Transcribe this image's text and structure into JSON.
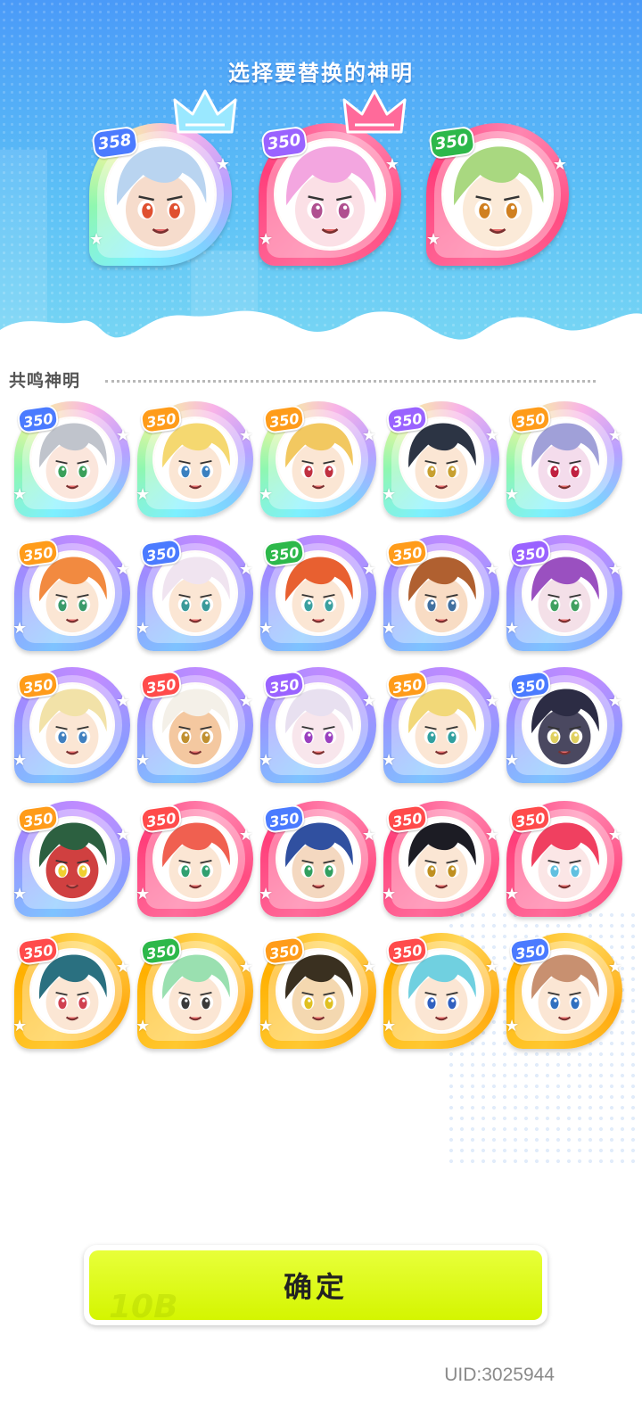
{
  "banner": {
    "title": "选择要替换的神明",
    "selected": [
      {
        "level": "358",
        "frame": "rainbow",
        "badge": "b-blue",
        "hair": "#b9d4f0",
        "skin": "#f6dccc",
        "eyes": "#e05030",
        "crown": "#9ae8ff",
        "crown_icon": "crown-icon"
      },
      {
        "level": "350",
        "frame": "pink",
        "badge": "b-purple",
        "hair": "#f3a6e0",
        "skin": "#fbe0e6",
        "eyes": "#b05090",
        "crown": "#ff6a9a",
        "crown_icon": "crown-icon"
      },
      {
        "level": "350",
        "frame": "pink",
        "badge": "b-green",
        "hair": "#a9d880",
        "skin": "#fbead8",
        "eyes": "#d08020",
        "crown": "",
        "crown_icon": ""
      }
    ]
  },
  "section": {
    "title": "共鸣神明"
  },
  "deities": [
    {
      "level": "350",
      "frame": "rainbow",
      "badge": "b-blue",
      "hair": "#c0c4cc",
      "skin": "#fbe6dc",
      "eyes": "#3aa05a"
    },
    {
      "level": "350",
      "frame": "rainbow",
      "badge": "b-orange",
      "hair": "#f5d870",
      "skin": "#fbe6d4",
      "eyes": "#3a80c0"
    },
    {
      "level": "350",
      "frame": "rainbow",
      "badge": "b-orange",
      "hair": "#f2c860",
      "skin": "#fbe6d4",
      "eyes": "#c03040"
    },
    {
      "level": "350",
      "frame": "rainbow",
      "badge": "b-purple",
      "hair": "#2c3444",
      "skin": "#fbe6d4",
      "eyes": "#c8a030"
    },
    {
      "level": "350",
      "frame": "rainbow",
      "badge": "b-orange",
      "hair": "#a0a0d8",
      "skin": "#f4dcec",
      "eyes": "#c02040"
    },
    {
      "level": "350",
      "frame": "purple",
      "badge": "b-orange",
      "hair": "#f28a40",
      "skin": "#fbe6d4",
      "eyes": "#3a9a6a"
    },
    {
      "level": "350",
      "frame": "purple",
      "badge": "b-blue",
      "hair": "#f0e4f0",
      "skin": "#fbe6d4",
      "eyes": "#3a9a9a"
    },
    {
      "level": "350",
      "frame": "purple",
      "badge": "b-green",
      "hair": "#e86030",
      "skin": "#fbe6d4",
      "eyes": "#3aa0a0"
    },
    {
      "level": "350",
      "frame": "purple",
      "badge": "b-orange",
      "hair": "#b06030",
      "skin": "#f8dcc4",
      "eyes": "#4070a0"
    },
    {
      "level": "350",
      "frame": "purple",
      "badge": "b-purple",
      "hair": "#9a50c0",
      "skin": "#f4e0e8",
      "eyes": "#40a060"
    },
    {
      "level": "350",
      "frame": "purple",
      "badge": "b-orange",
      "hair": "#f2e2a8",
      "skin": "#fbe6d4",
      "eyes": "#4080c0"
    },
    {
      "level": "350",
      "frame": "purple",
      "badge": "b-red",
      "hair": "#f4f0e8",
      "skin": "#f4c8a0",
      "eyes": "#c09030"
    },
    {
      "level": "350",
      "frame": "purple",
      "badge": "b-purple",
      "hair": "#e8e0f0",
      "skin": "#f8e6ec",
      "eyes": "#9a40c0"
    },
    {
      "level": "350",
      "frame": "purple",
      "badge": "b-orange",
      "hair": "#f2d878",
      "skin": "#fbe6d4",
      "eyes": "#30a0a0"
    },
    {
      "level": "350",
      "frame": "purple",
      "badge": "b-blue",
      "hair": "#2c2c44",
      "skin": "#4a4860",
      "eyes": "#e0d060"
    },
    {
      "level": "350",
      "frame": "purple",
      "badge": "b-orange",
      "hair": "#2c6040",
      "skin": "#d04040",
      "eyes": "#f0d030"
    },
    {
      "level": "350",
      "frame": "pink",
      "badge": "b-red",
      "hair": "#f06050",
      "skin": "#fbe6d4",
      "eyes": "#30a070"
    },
    {
      "level": "350",
      "frame": "pink",
      "badge": "b-blue",
      "hair": "#3050a0",
      "skin": "#f4d8c0",
      "eyes": "#30a060"
    },
    {
      "level": "350",
      "frame": "pink",
      "badge": "b-red",
      "hair": "#1c1c24",
      "skin": "#fbe6d4",
      "eyes": "#c09020"
    },
    {
      "level": "350",
      "frame": "pink",
      "badge": "b-red",
      "hair": "#f04060",
      "skin": "#fbe6e6",
      "eyes": "#60c0e0"
    },
    {
      "level": "350",
      "frame": "gold",
      "badge": "b-red",
      "hair": "#2a7080",
      "skin": "#fbe6d4",
      "eyes": "#d04050"
    },
    {
      "level": "350",
      "frame": "gold",
      "badge": "b-green",
      "hair": "#9ae0b0",
      "skin": "#fbe6d4",
      "eyes": "#3a3a3a"
    },
    {
      "level": "350",
      "frame": "gold",
      "badge": "b-orange",
      "hair": "#3a3020",
      "skin": "#f4d8b0",
      "eyes": "#e0c020"
    },
    {
      "level": "350",
      "frame": "gold",
      "badge": "b-red",
      "hair": "#70d0e0",
      "skin": "#fbe6d4",
      "eyes": "#3060c0"
    },
    {
      "level": "350",
      "frame": "gold",
      "badge": "b-blue",
      "hair": "#c89070",
      "skin": "#fbe6d4",
      "eyes": "#3070c0"
    }
  ],
  "confirm": {
    "label": "确定"
  },
  "footer": {
    "uid": "UID:3025944"
  },
  "colors": {
    "banner_top": "#4a9af8",
    "banner_bottom": "#7ad8f4",
    "button": "#d4f500",
    "title_text": "#555555"
  }
}
